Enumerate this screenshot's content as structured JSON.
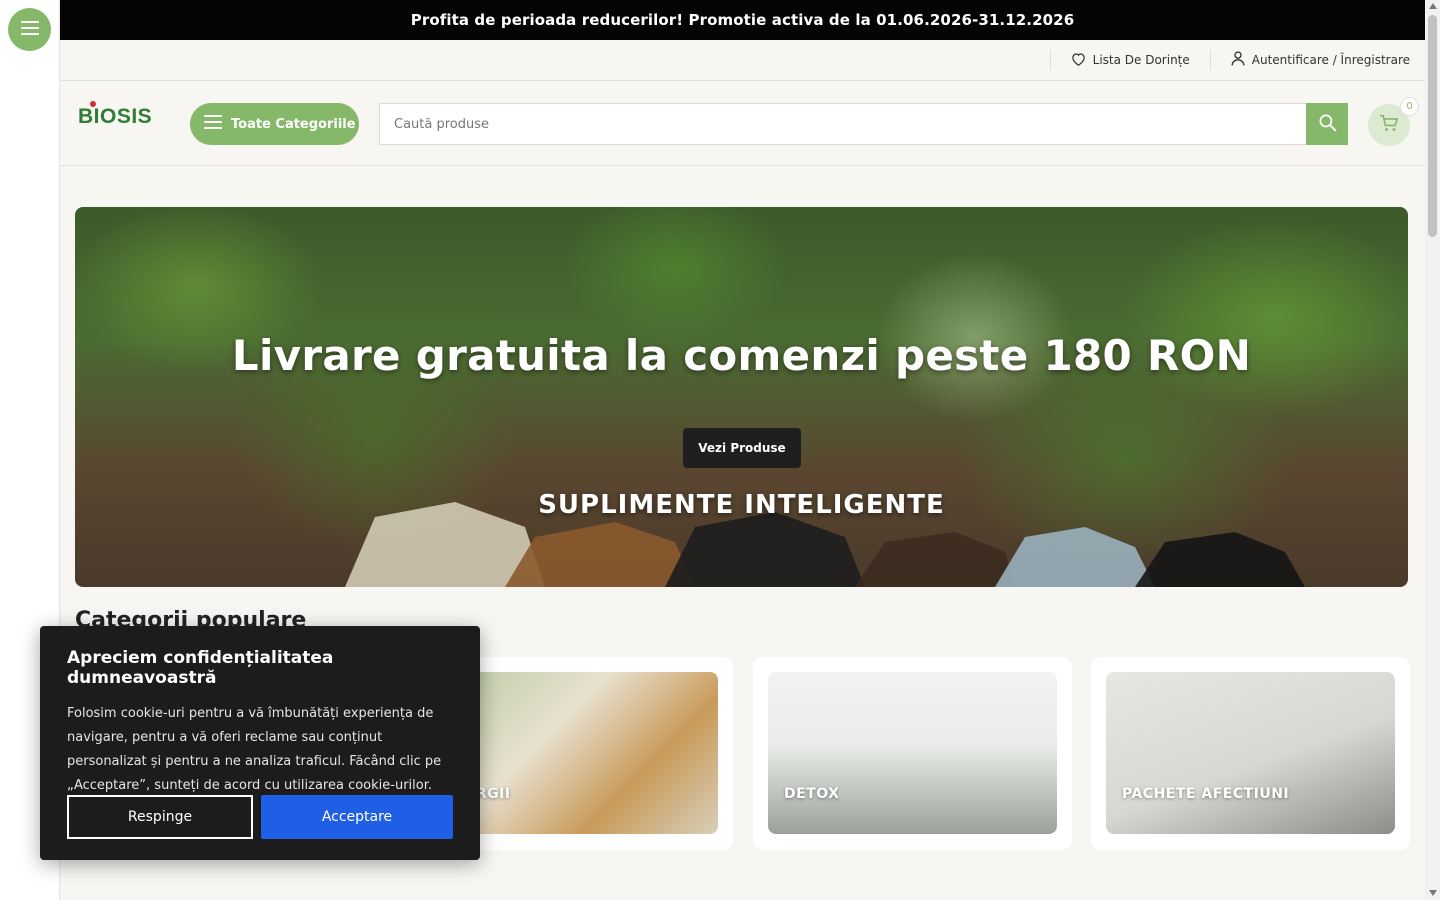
{
  "promo": {
    "text": "Profita de perioada reducerilor! Promotie activa de la 01.06.2026-31.12.2026"
  },
  "topbar": {
    "wishlist_label": "Lista De Dorințe",
    "auth_label": "Autentificare / Înregistrare"
  },
  "header": {
    "logo_text": "BIOSIS",
    "categories_button": "Toate Categoriile",
    "search_placeholder": "Caută produse",
    "cart_count": "0"
  },
  "hero": {
    "title": "Livrare gratuita la comenzi peste 180 RON",
    "button_label": "Vezi Produse",
    "subtitle": "SUPLIMENTE  INTELIGENTE"
  },
  "categories": {
    "section_title": "Categorii populare",
    "items": [
      {
        "label": "ALERGII"
      },
      {
        "label": "DETOX"
      },
      {
        "label": "PACHETE AFECTIUNI"
      }
    ]
  },
  "cookie": {
    "title": "Apreciem confidențialitatea dumneavoastră",
    "body": "Folosim cookie-uri pentru a vă îmbunătăți experiența de navigare, pentru a vă oferi reclame sau conținut personalizat și pentru a ne analiza traficul. Făcând clic pe „Acceptare”, sunteți de acord cu utilizarea cookie-urilor.",
    "reject_label": "Respinge",
    "accept_label": "Acceptare"
  },
  "colors": {
    "accent_green": "#86b86a",
    "accept_blue": "#1f5fe6",
    "promo_bg": "#050505"
  },
  "icons": [
    "hamburger-icon",
    "heart-icon",
    "user-icon",
    "search-icon",
    "cart-icon"
  ]
}
